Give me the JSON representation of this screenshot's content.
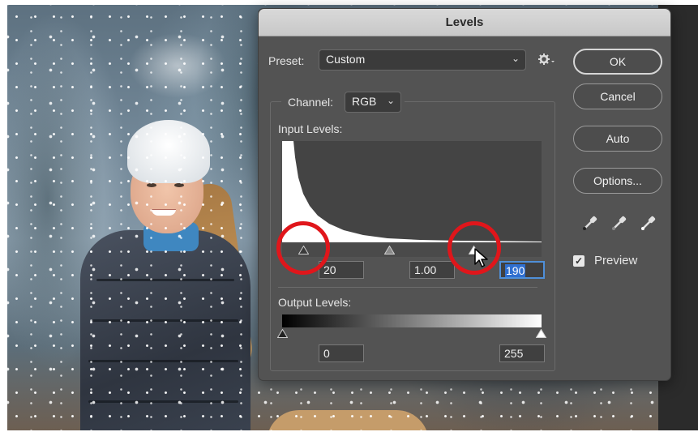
{
  "dialog": {
    "title": "Levels",
    "preset": {
      "label": "Preset:",
      "value": "Custom"
    },
    "channel": {
      "label": "Channel:",
      "value": "RGB"
    },
    "input_levels": {
      "label": "Input Levels:",
      "black": "20",
      "gamma": "1.00",
      "white": "190"
    },
    "output_levels": {
      "label": "Output Levels:",
      "black": "0",
      "white": "255"
    },
    "buttons": {
      "ok": "OK",
      "cancel": "Cancel",
      "auto": "Auto",
      "options": "Options..."
    },
    "preview": {
      "label": "Preview",
      "checked": true
    },
    "eyedroppers": [
      "black-point-eyedropper-icon",
      "gray-point-eyedropper-icon",
      "white-point-eyedropper-icon"
    ]
  },
  "annotations": {
    "highlight_color": "#e0161b"
  },
  "colors": {
    "dialog_bg": "#535353",
    "histogram_bg": "#444444",
    "focus_blue": "#2f6fd0"
  }
}
